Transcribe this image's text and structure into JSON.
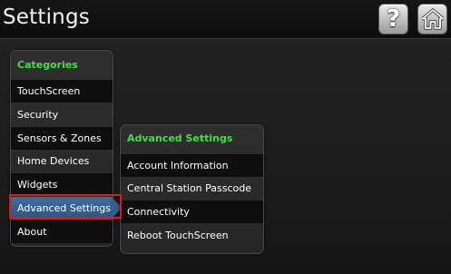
{
  "header": {
    "title": "Settings",
    "help_icon": "question-mark-icon",
    "home_icon": "home-icon"
  },
  "categories": {
    "header": "Categories",
    "items": [
      {
        "label": "TouchScreen"
      },
      {
        "label": "Security"
      },
      {
        "label": "Sensors & Zones"
      },
      {
        "label": "Home Devices"
      },
      {
        "label": "Widgets"
      },
      {
        "label": "Advanced Settings",
        "selected": true
      },
      {
        "label": "About"
      }
    ]
  },
  "advanced_settings": {
    "header": "Advanced Settings",
    "items": [
      {
        "label": "Account Information"
      },
      {
        "label": "Central Station Passcode"
      },
      {
        "label": "Connectivity"
      },
      {
        "label": "Reboot TouchScreen"
      }
    ]
  },
  "colors": {
    "panel_header_text": "#3fe03f",
    "selected_row": "#3a6898",
    "highlight_box": "#e01818"
  }
}
